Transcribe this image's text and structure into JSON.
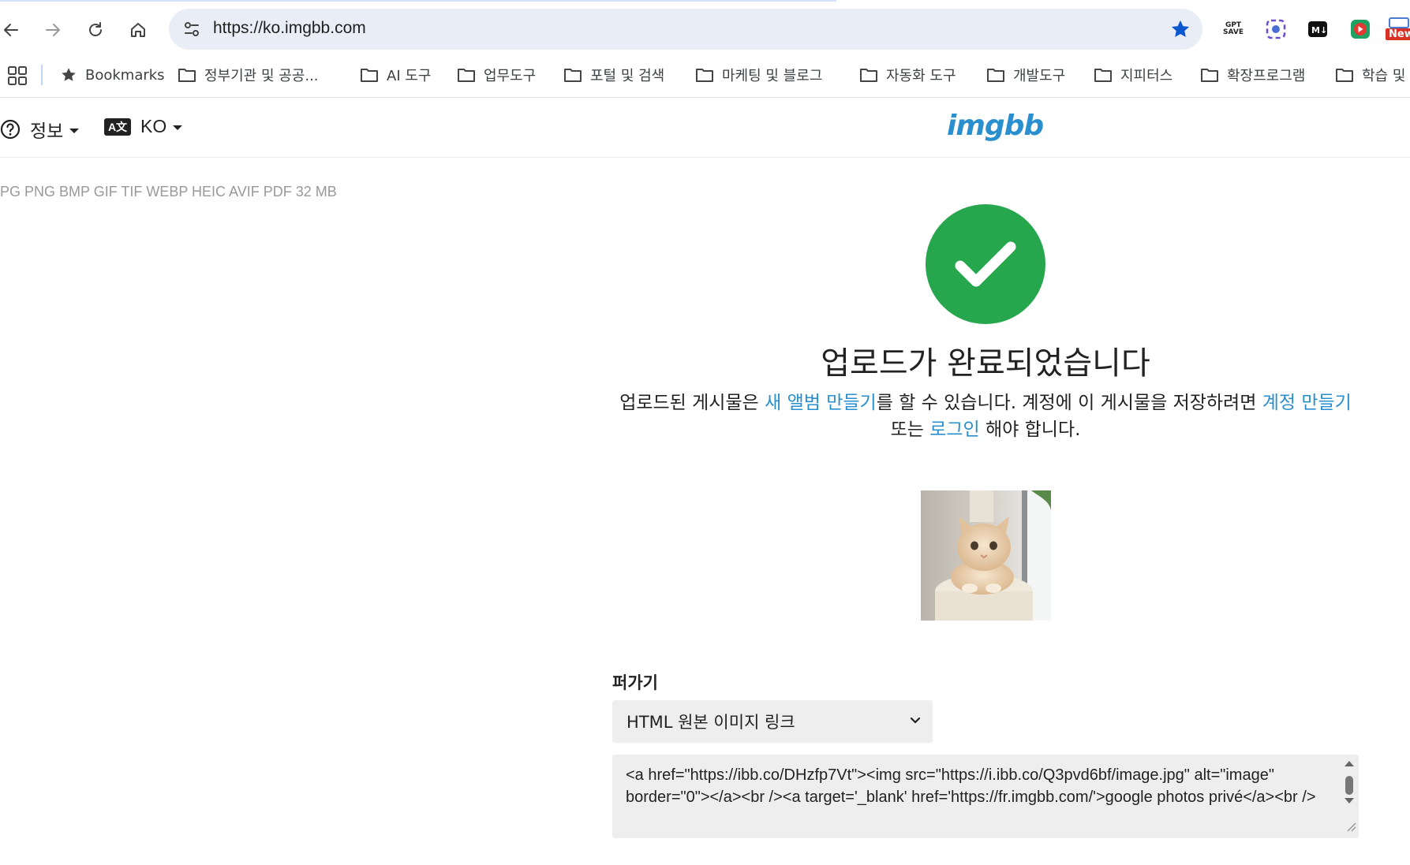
{
  "browser": {
    "url": "https://ko.imgbb.com",
    "bookmarks_label": "Bookmarks",
    "folders": [
      "정부기관 및 공공...",
      "AI 도구",
      "업무도구",
      "포털 및 검색",
      "마케팅 및 블로그",
      "자동화 도구",
      "개발도구",
      "지피터스",
      "확장프로그램",
      "학습 및"
    ],
    "extensions": [
      "gpt-save-icon",
      "screen-capture-icon",
      "markdown-icon",
      "record-icon",
      "new-badge-icon"
    ],
    "ext_text": {
      "gpt_save": "GPT SAVE",
      "new_badge": "New"
    }
  },
  "header": {
    "info_label": "정보",
    "lang_label": "KO",
    "lang_icon_text": "A文",
    "logo": "imgbb"
  },
  "formats_text": "PG PNG BMP GIF TIF WEBP HEIC AVIF PDF   32 MB",
  "success": {
    "title": "업로드가 완료되었습니다",
    "desc_1": "업로드된 게시물은 ",
    "link_album": "새 앨범 만들기",
    "desc_2": "를 할 수 있습니다. 계정에 이 게시물을 저장하려면 ",
    "link_signup": "계정 만들기",
    "desc_3": " 또는 ",
    "link_login": "로그인",
    "desc_4": " 해야 합니다."
  },
  "embed": {
    "label": "퍼가기",
    "selected": "HTML 원본 이미지 링크",
    "code": "<a href=\"https://ibb.co/DHzfp7Vt\"><img src=\"https://i.ibb.co/Q3pvd6bf/image.jpg\" alt=\"image\" border=\"0\"></a><br /><a target='_blank' href='https://fr.imgbb.com/'>google photos privé</a><br />"
  },
  "colors": {
    "accent": "#2a8fce",
    "success": "#27a74d",
    "panel": "#eeeeee"
  }
}
